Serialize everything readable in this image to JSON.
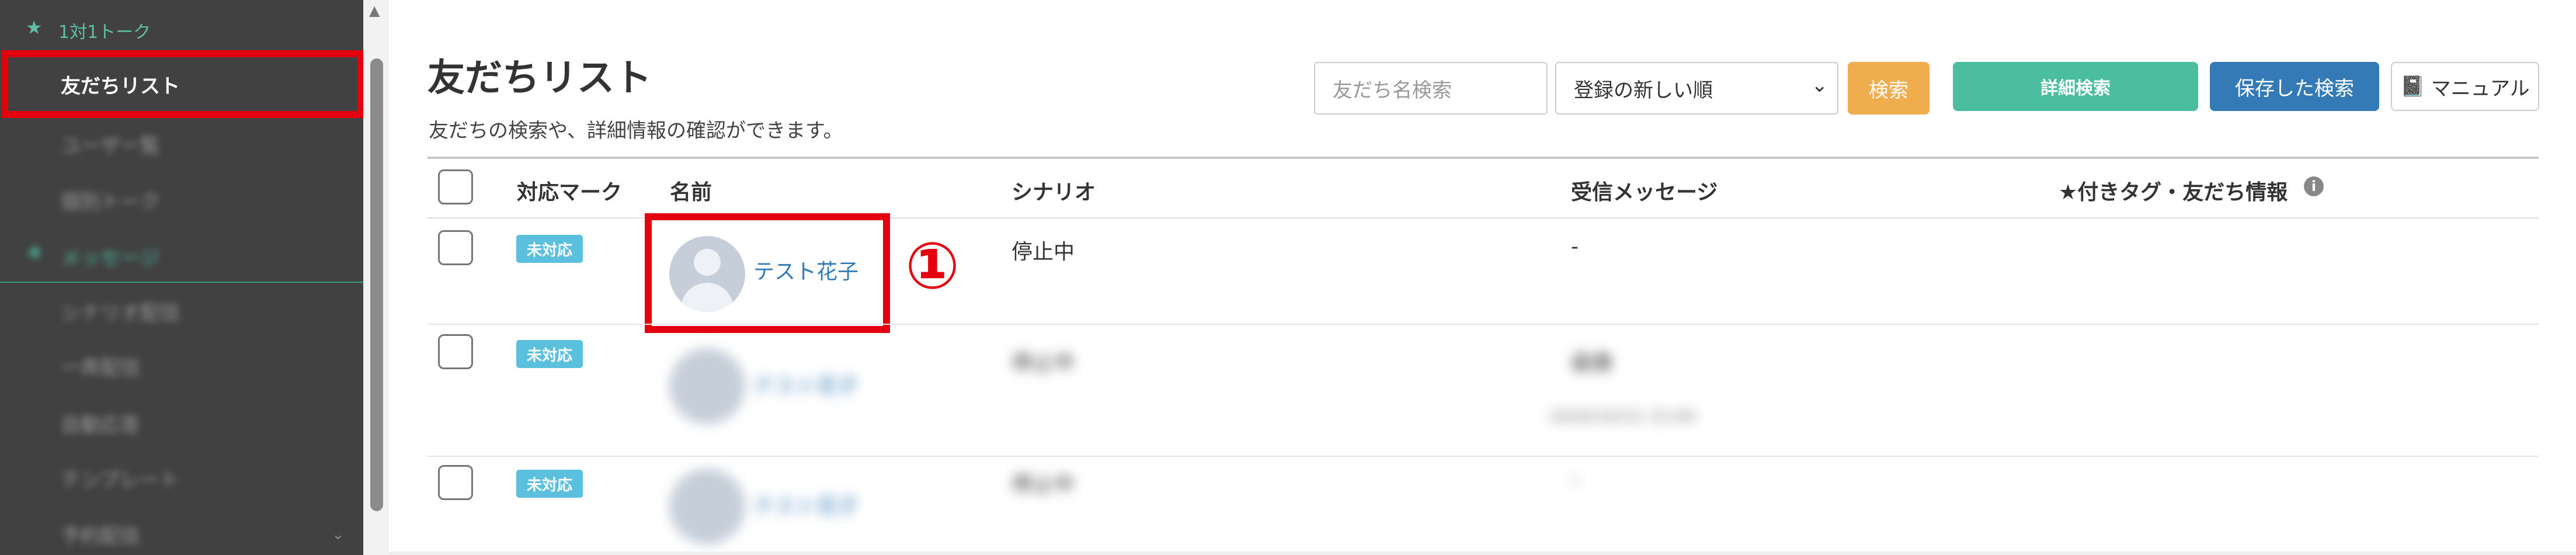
{
  "sidebar": {
    "section_title": "1対1トーク",
    "active_item": "友だちリスト",
    "blurred_items": [
      "ユーザー覧",
      "個別トーク",
      "メッセージ",
      "シナリオ配信",
      "一斉配信",
      "自動応答",
      "テンプレート",
      "予約配信"
    ]
  },
  "header": {
    "title": "友だちリスト",
    "subtitle": "友だちの検索や、詳細情報の確認ができます。",
    "search_placeholder": "友だち名検索",
    "sort_selected": "登録の新しい順",
    "search_label": "検索",
    "advanced_search_label": "詳細検索",
    "saved_search_label": "保存した検索",
    "manual_label": "マニュアル"
  },
  "table": {
    "columns": [
      "対応マーク",
      "名前",
      "シナリオ",
      "受信メッセージ",
      "★付きタグ・友だち情報"
    ],
    "rows": [
      {
        "badge": "未対応",
        "name": "テスト花子",
        "scenario": "停止中",
        "message": "-"
      },
      {
        "badge": "未対応",
        "name": "テスト花子",
        "scenario": "停止中",
        "message": "画像",
        "message_sub": "2020/10/15 15:00"
      },
      {
        "badge": "未対応",
        "name": "テスト花子",
        "scenario": "停止中",
        "message": "-"
      }
    ]
  },
  "annotation": {
    "number": "①"
  },
  "colors": {
    "sidebar_bg": "#414141",
    "accent_green": "#4cbea0",
    "primary_blue": "#337ab7",
    "search_orange": "#f0ad4e",
    "badge_blue": "#5bc0de",
    "highlight_red": "#e4000f"
  }
}
